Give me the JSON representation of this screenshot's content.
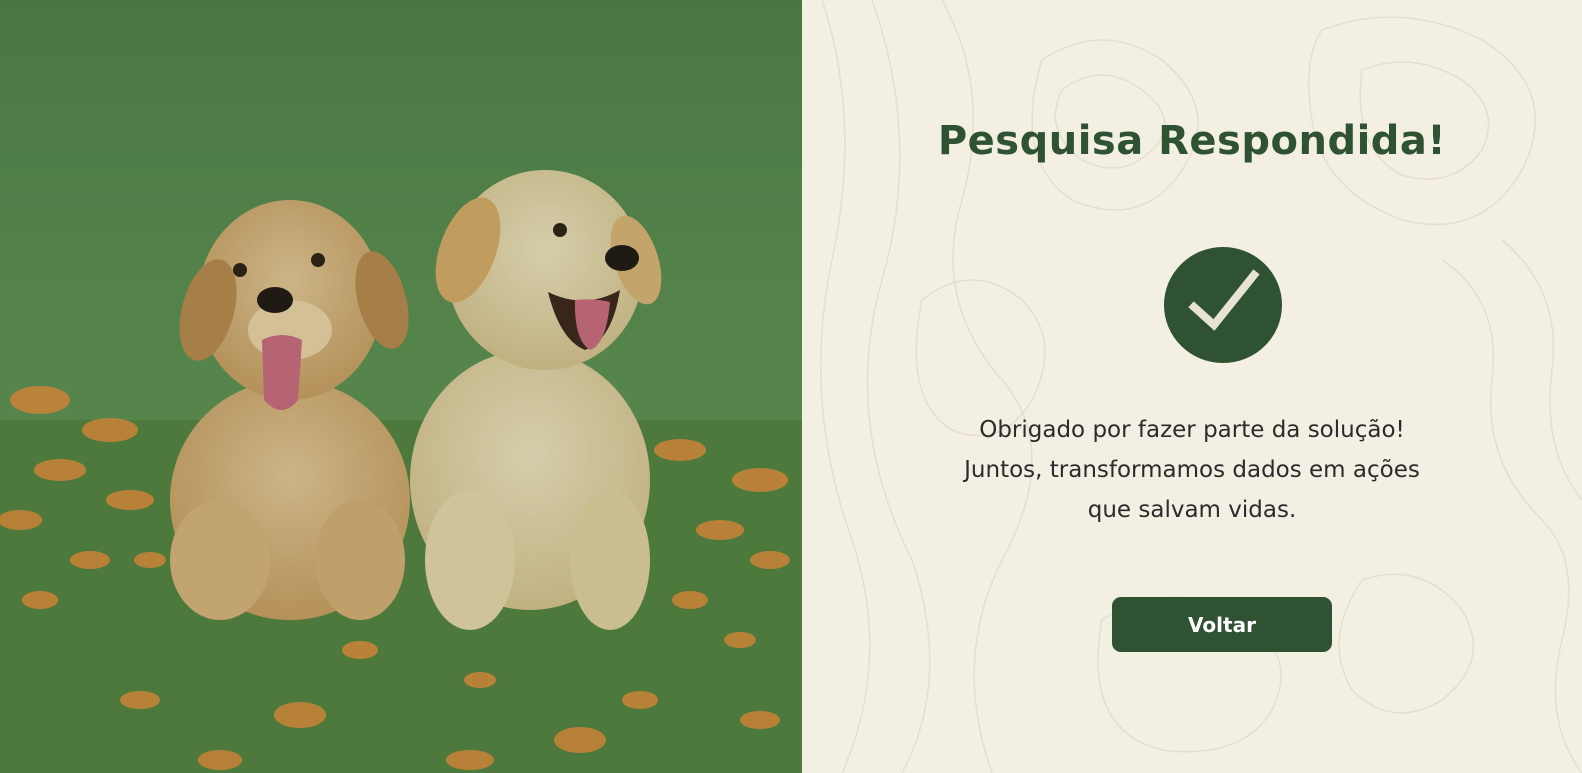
{
  "result": {
    "title": "Pesquisa Respondida!",
    "message_lines": [
      "Obrigado por fazer parte da solução!",
      "Juntos, transformamos dados em ações",
      "que salvam vidas."
    ],
    "back_button_label": "Voltar",
    "icon": "check-icon"
  },
  "colors": {
    "brand_green": "#2f5233",
    "panel_background": "#f3efe2",
    "text": "#2b2b2b",
    "button_text": "#ffffff"
  }
}
